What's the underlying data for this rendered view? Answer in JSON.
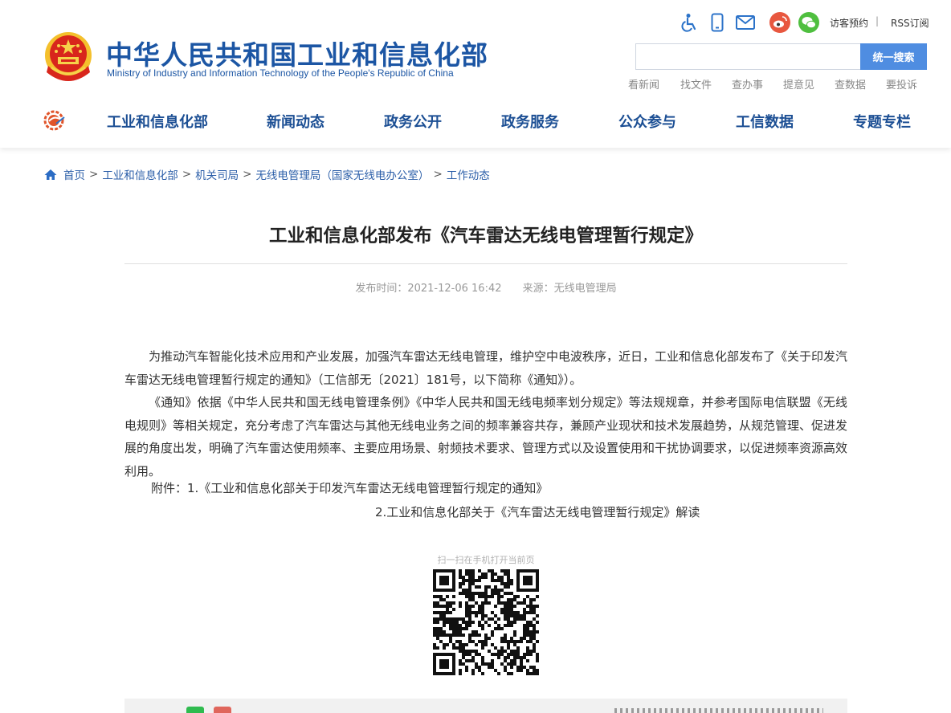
{
  "header": {
    "site_name_cn": "中华人民共和国工业和信息化部",
    "site_name_en": "Ministry of Industry and Information Technology of the People's Republic of China",
    "top_links": [
      "访客预约",
      "RSS订阅"
    ],
    "top_separator": "|",
    "tool_icons": [
      "accessibility-icon",
      "mobile-icon",
      "mail-icon",
      "weibo-icon",
      "wechat-icon"
    ],
    "search": {
      "placeholder": "",
      "button_label": "统一搜索"
    },
    "quick_links": [
      "看新闻",
      "找文件",
      "查办事",
      "提意见",
      "查数据",
      "要投诉"
    ]
  },
  "nav": {
    "items": [
      "工业和信息化部",
      "新闻动态",
      "政务公开",
      "政务服务",
      "公众参与",
      "工信数据",
      "专题专栏"
    ]
  },
  "breadcrumb": {
    "items": [
      "首页",
      "工业和信息化部",
      "机关司局",
      "无线电管理局（国家无线电办公室）",
      "工作动态"
    ],
    "separator": ">"
  },
  "article": {
    "title": "工业和信息化部发布《汽车雷达无线电管理暂行规定》",
    "publish_time": "发布时间：2021-12-06 16:42",
    "source": "来源：无线电管理局",
    "paragraphs": [
      "为推动汽车智能化技术应用和产业发展，加强汽车雷达无线电管理，维护空中电波秩序，近日，工业和信息化部发布了《关于印发汽车雷达无线电管理暂行规定的通知》（工信部无〔2021〕181号，以下简称《通知》）。",
      "《通知》依据《中华人民共和国无线电管理条例》《中华人民共和国无线电频率划分规定》等法规规章，并参考国际电信联盟《无线电规则》等相关规定，充分考虑了汽车雷达与其他无线电业务之间的频率兼容共存，兼顾产业现状和技术发展趋势，从规范管理、促进发展的角度出发，明确了汽车雷达使用频率、主要应用场景、射频技术要求、管理方式以及设置使用和干扰协调要求，以促进频率资源高效利用。"
    ],
    "attachment_1": "附件：1.《工业和信息化部关于印发汽车雷达无线电管理暂行规定的通知》",
    "attachment_2": "2.工业和信息化部关于《汽车雷达无线电管理暂行规定》解读",
    "qr_caption": "扫一扫在手机打开当前页"
  },
  "colors": {
    "brand_blue": "#1c56a4",
    "nav_blue": "#1c4f94",
    "link_blue": "#2b5ea8",
    "search_button": "#4f8de1"
  }
}
